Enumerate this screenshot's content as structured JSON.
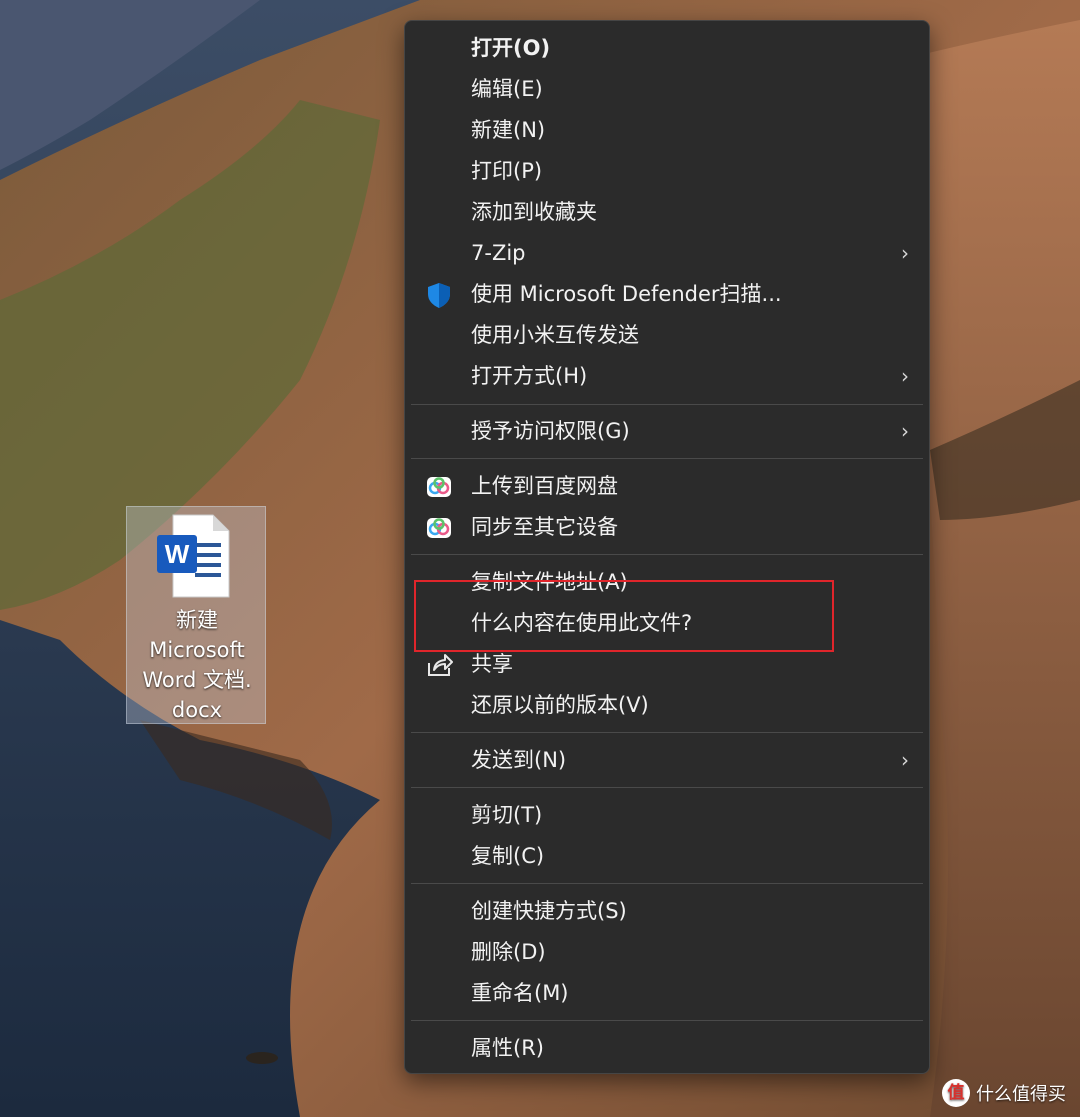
{
  "desktop": {
    "file": {
      "name": "新建\nMicrosoft\nWord 文档.\ndocx",
      "icon": "word-document-icon"
    }
  },
  "context_menu": {
    "items": [
      {
        "label": "打开(O)",
        "bold": true
      },
      {
        "label": "编辑(E)"
      },
      {
        "label": "新建(N)"
      },
      {
        "label": "打印(P)"
      },
      {
        "label": "添加到收藏夹"
      },
      {
        "label": "7-Zip",
        "submenu": true
      },
      {
        "label": "使用 Microsoft Defender扫描...",
        "icon": "defender-shield-icon"
      },
      {
        "label": "使用小米互传发送"
      },
      {
        "label": "打开方式(H)",
        "submenu": true
      },
      {
        "label": "授予访问权限(G)",
        "submenu": true
      },
      {
        "label": "上传到百度网盘",
        "icon": "baidu-netdisk-icon"
      },
      {
        "label": "同步至其它设备",
        "icon": "baidu-netdisk-icon"
      },
      {
        "label": "复制文件地址(A)"
      },
      {
        "label": "什么内容在使用此文件?"
      },
      {
        "label": "共享",
        "icon": "share-icon"
      },
      {
        "label": "还原以前的版本(V)"
      },
      {
        "label": "发送到(N)",
        "submenu": true
      },
      {
        "label": "剪切(T)"
      },
      {
        "label": "复制(C)"
      },
      {
        "label": "创建快捷方式(S)"
      },
      {
        "label": "删除(D)"
      },
      {
        "label": "重命名(M)"
      },
      {
        "label": "属性(R)"
      }
    ],
    "submenu_glyph": "›",
    "highlight_color": "#e0252b"
  },
  "watermark": {
    "logo_text": "值",
    "text": "什么值得买"
  }
}
